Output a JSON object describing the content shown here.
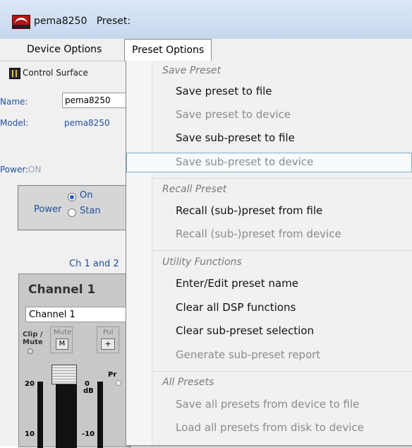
{
  "window": {
    "app_name": "pema8250",
    "title_suffix": "Preset:"
  },
  "menubar": {
    "device_options": "Device Options",
    "preset_options": "Preset Options"
  },
  "left_panel": {
    "control_surface": "Control Surface",
    "name_label": "Name:",
    "name_value": "pema8250",
    "model_label": "Model:",
    "model_value": "pema8250",
    "power_label": "Power:",
    "power_status": "ON",
    "power_group_label": "Power",
    "power_on": "On",
    "power_standby": "Stan",
    "ch_text": "Ch 1 and 2",
    "channel": {
      "title": "Channel 1",
      "name": "Channel 1",
      "clip_mute": "Clip / Mute",
      "mute_label": "Mute",
      "mute_button": "M",
      "pol_label": "Pol",
      "pol_button": "+",
      "scale_20": "20",
      "scale_10": "10",
      "db_0": "0",
      "db_unit": "dB",
      "db_minus10": "-10",
      "pr_label": "Pr"
    }
  },
  "preset_menu": {
    "save_header": "Save Preset",
    "save_to_file": "Save preset to file",
    "save_to_device": "Save preset to device",
    "save_sub_to_file": "Save sub-preset to file",
    "save_sub_to_device": "Save sub-preset to device",
    "recall_header": "Recall Preset",
    "recall_from_file": "Recall (sub-)preset from file",
    "recall_from_device": "Recall (sub-)preset from device",
    "utility_header": "Utility Functions",
    "edit_name": "Enter/Edit preset name",
    "clear_dsp": "Clear all DSP functions",
    "clear_sub": "Clear sub-preset selection",
    "generate_report": "Generate sub-preset report",
    "all_header": "All Presets",
    "save_all": "Save all presets from device to file",
    "load_all": "Load all presets from disk to device"
  },
  "colors": {
    "accent_blue": "#1f4f9e",
    "hover_border": "#7aaed3",
    "app_icon_red": "#b31313"
  }
}
